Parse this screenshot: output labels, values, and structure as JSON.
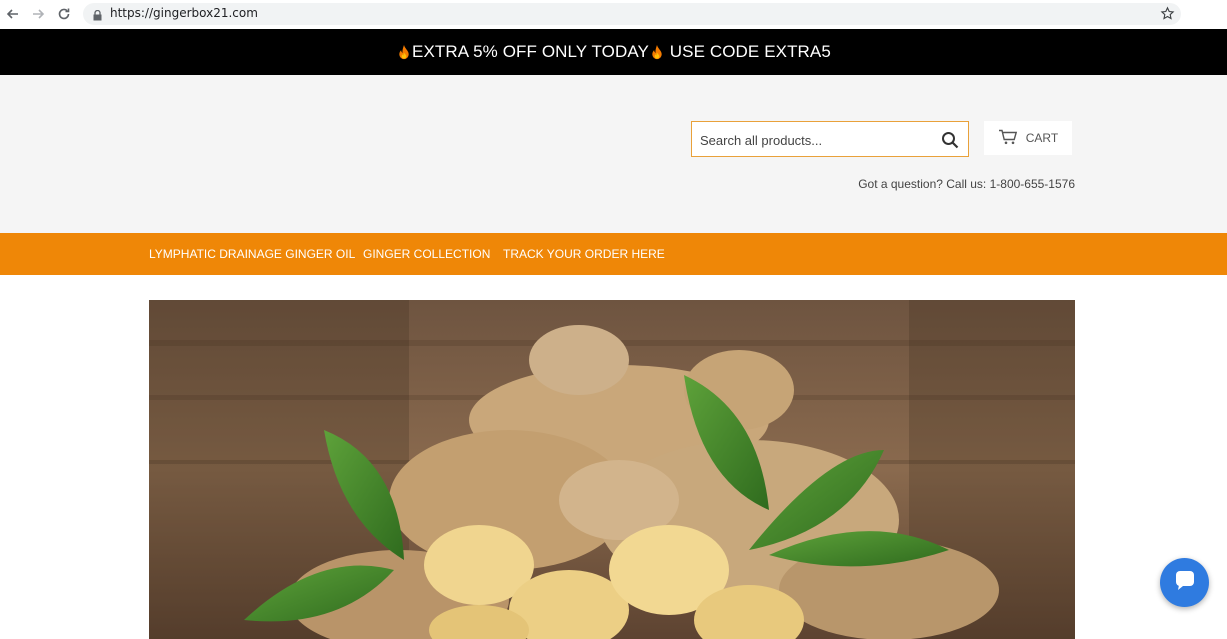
{
  "browser": {
    "url": "https://gingerbox21.com"
  },
  "announcement": {
    "part1": "EXTRA 5% OFF ONLY TODAY",
    "part2": " USE CODE EXTRA5"
  },
  "header": {
    "search_placeholder": "Search all products...",
    "cart_label": "CART",
    "phone_text": "Got a question? Call us: 1-800-655-1576"
  },
  "nav": {
    "items": [
      {
        "label": "LYMPHATIC DRAINAGE GINGER OIL"
      },
      {
        "label": "GINGER COLLECTION"
      },
      {
        "label": "TRACK YOUR ORDER HERE"
      }
    ]
  },
  "colors": {
    "announcement_bg": "#000000",
    "nav_bg": "#ef8707",
    "search_border": "#e9a13a",
    "chat_button": "#2f7be0"
  },
  "icons": [
    "back-arrow-icon",
    "forward-arrow-icon",
    "reload-icon",
    "lock-icon",
    "star-icon",
    "fire-icon",
    "search-icon",
    "cart-icon",
    "chat-icon"
  ]
}
